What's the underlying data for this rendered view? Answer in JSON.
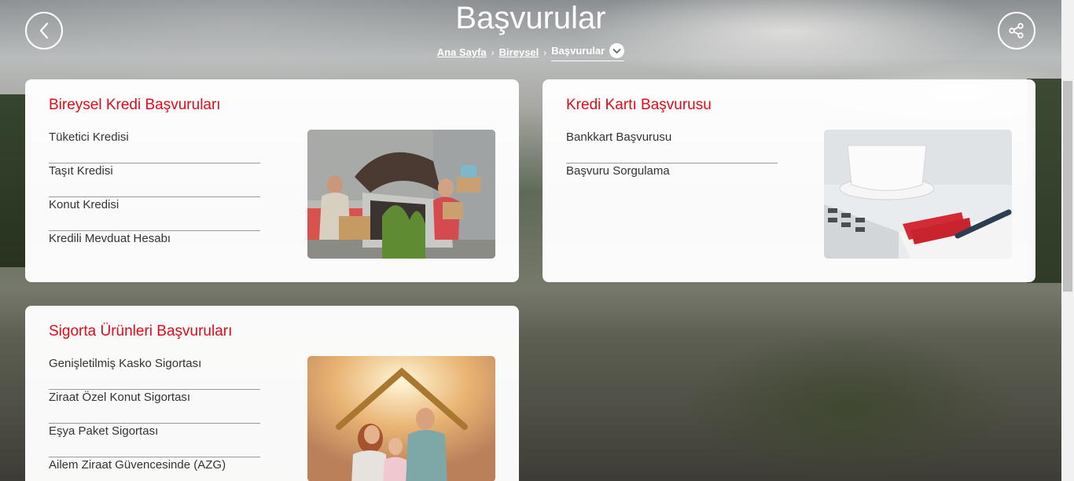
{
  "header": {
    "title": "Başvurular",
    "breadcrumb": {
      "home": "Ana Sayfa",
      "parent": "Bireysel",
      "current": "Başvurular"
    }
  },
  "icons": {
    "back": "chevron-left-icon",
    "share": "share-icon",
    "dropdown": "chevron-down-icon"
  },
  "colors": {
    "accent": "#e30a17",
    "card_bg": "#ffffff",
    "text": "#333333"
  },
  "cards": [
    {
      "title": "Bireysel Kredi Başvuruları",
      "items": [
        "Tüketici Kredisi",
        "Taşıt Kredisi",
        "Konut Kredisi",
        "Kredili Mevduat Hesabı"
      ]
    },
    {
      "title": "Kredi Kartı Başvurusu",
      "items": [
        "Bankkart Başvurusu",
        "Başvuru Sorgulama"
      ]
    },
    {
      "title": "Sigorta Ürünleri Başvuruları",
      "items": [
        "Genişletilmiş Kasko Sigortası",
        "Ziraat Özel Konut Sigortası",
        "Eşya Paket Sigortası",
        "Ailem Ziraat Güvencesinde (AZG)"
      ]
    }
  ]
}
